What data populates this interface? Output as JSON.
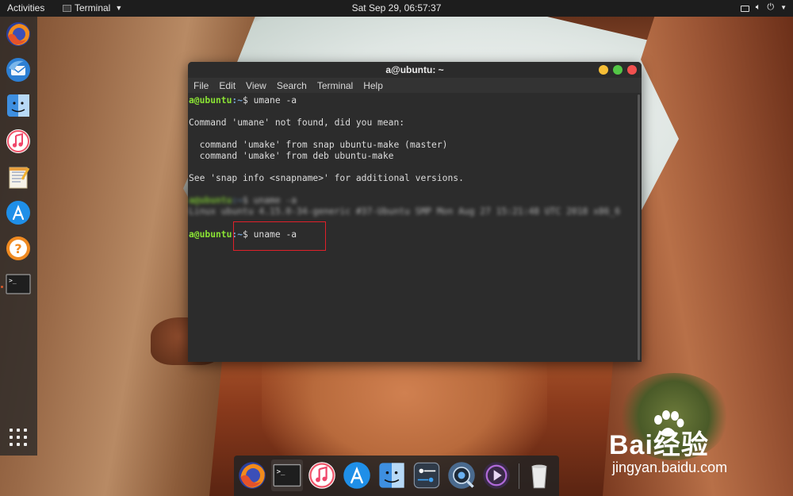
{
  "topbar": {
    "activities_label": "Activities",
    "app_menu_label": "Terminal",
    "clock": "Sat Sep 29, 06:57:37"
  },
  "left_dock": {
    "items": [
      {
        "name": "firefox",
        "icon": "firefox-icon"
      },
      {
        "name": "thunderbird",
        "icon": "mail-icon"
      },
      {
        "name": "files",
        "icon": "files-icon"
      },
      {
        "name": "music",
        "icon": "music-icon"
      },
      {
        "name": "text-editor",
        "icon": "text-editor-icon"
      },
      {
        "name": "app-store",
        "icon": "app-store-icon"
      },
      {
        "name": "help",
        "icon": "help-icon"
      },
      {
        "name": "terminal",
        "icon": "terminal-icon",
        "running": true
      }
    ],
    "show_apps_icon": "grid-icon"
  },
  "terminal": {
    "title": "a@ubuntu: ~",
    "menu": [
      "File",
      "Edit",
      "View",
      "Search",
      "Terminal",
      "Help"
    ],
    "lines": [
      {
        "user": "a@ubuntu",
        "path": ":~",
        "cmd": "$ umane -a"
      },
      {
        "text": "Command 'umane' not found, did you mean:"
      },
      {
        "text": "  command 'umake' from snap ubuntu-make (master)"
      },
      {
        "text": "  command 'umake' from deb ubuntu-make"
      },
      {
        "text": "See 'snap info <snapname>' for additional versions."
      },
      {
        "user": "a@ubuntu",
        "path": ":~",
        "cmd": "$ uname -a",
        "blurred": true
      },
      {
        "text": "Linux ubuntu 4.15.0-34-generic #37-Ubuntu SMP Mon Aug 27 15:21:48 UTC 2018 x86_6",
        "blurred": true
      },
      {
        "user": "a@ubuntu",
        "path": ":~",
        "cmd": "$ uname -a"
      }
    ]
  },
  "bottom_dock": {
    "items": [
      "firefox-icon",
      "terminal-icon",
      "music-icon",
      "app-store-icon",
      "files-icon",
      "settings-icon",
      "screenshot-icon",
      "video-icon",
      "trash-icon"
    ]
  },
  "watermark": {
    "main": "Bai经验",
    "sub": "jingyan.baidu.com"
  },
  "colors": {
    "prompt_user": "#8ae234",
    "prompt_path": "#729fcf",
    "terminal_bg": "#2c2c2c",
    "highlight": "#e0202a"
  }
}
